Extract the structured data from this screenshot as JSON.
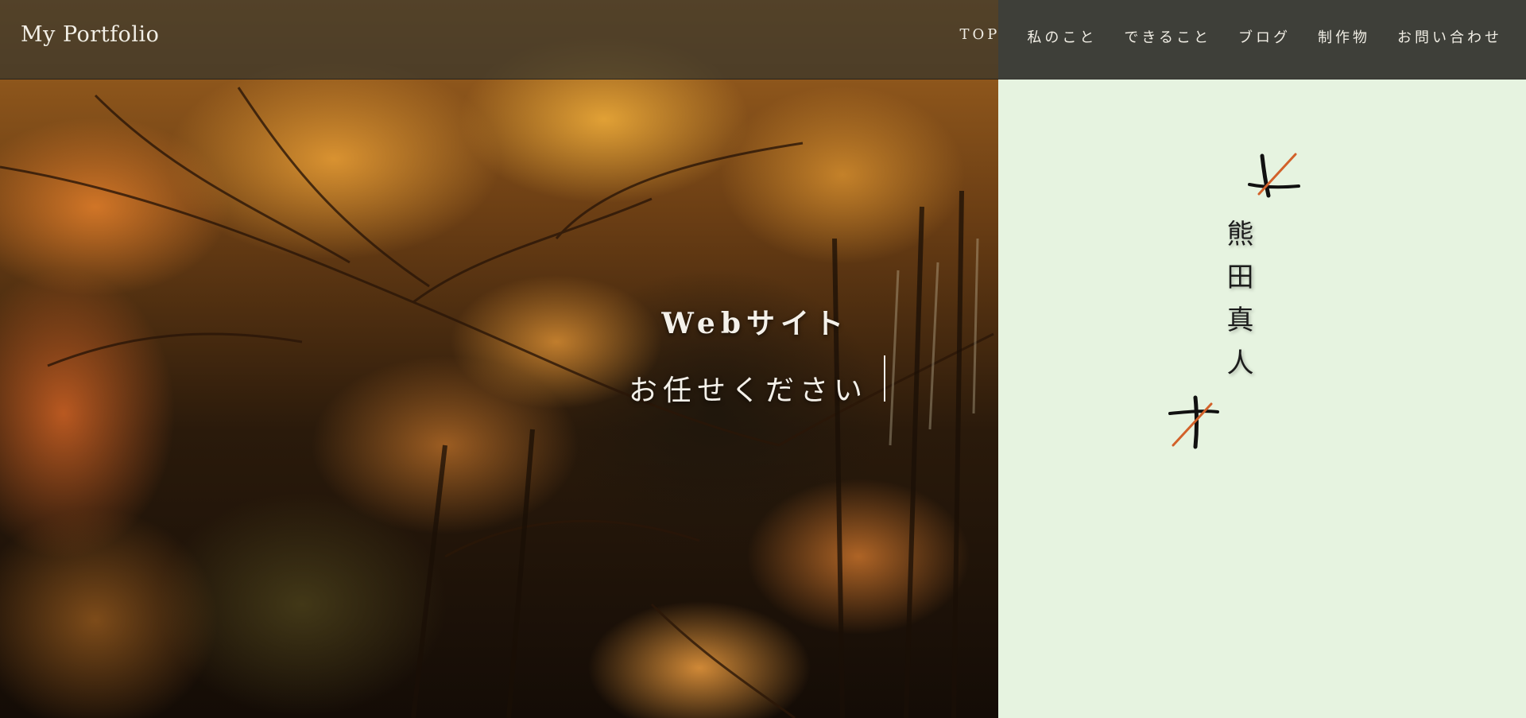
{
  "header": {
    "logo": "My Portfolio",
    "nav": [
      "TOP",
      "私のこと",
      "できること",
      "ブログ",
      "制作物",
      "お問い合わせ"
    ]
  },
  "hero": {
    "catch_line_1": "Webサイト",
    "catch_line_2": "お任せください",
    "image": "autumn-maple-forest-photo"
  },
  "side": {
    "name": "熊田真人"
  },
  "colors": {
    "header_bg": "#3e3f39",
    "side_bg": "#e6f3e0",
    "accent": "#d2612a",
    "name_text": "#1c1c1c"
  }
}
